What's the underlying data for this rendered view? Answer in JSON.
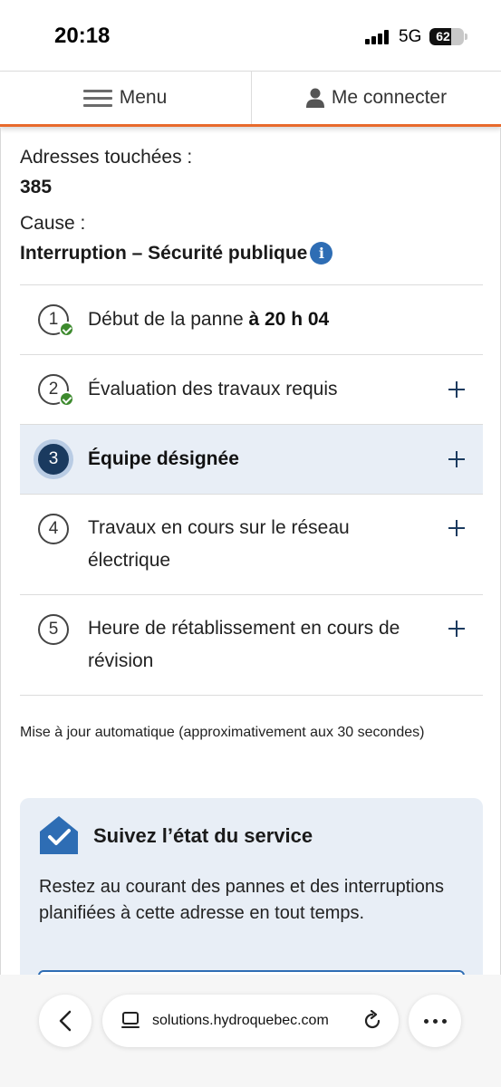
{
  "status_bar": {
    "time": "20:18",
    "network": "5G",
    "battery_level": "62",
    "battery_fraction": 0.62
  },
  "header": {
    "menu_label": "Menu",
    "menu_icon": "hamburger-icon",
    "login_label": "Me connecter",
    "login_icon": "user-icon",
    "accent_color": "#e86a2c"
  },
  "outage": {
    "addresses_label": "Adresses touchées :",
    "addresses_value": "385",
    "cause_label": "Cause :",
    "cause_value": "Interruption – Sécurité publique",
    "cause_info_icon": "info-icon",
    "cause_info_glyph": "i"
  },
  "steps": [
    {
      "number": "1",
      "label": "Début de la panne ",
      "detail": "à 20 h 04",
      "status": "done",
      "expandable": false
    },
    {
      "number": "2",
      "label": "Évaluation des travaux requis",
      "detail": "",
      "status": "done",
      "expandable": true
    },
    {
      "number": "3",
      "label": "Équipe désignée",
      "detail": "",
      "status": "current",
      "expandable": true
    },
    {
      "number": "4",
      "label_line1": "Travaux en cours sur le réseau",
      "label_line2": "électrique",
      "status": "pending",
      "expandable": true
    },
    {
      "number": "5",
      "label_line1": "Heure de rétablissement en cours de",
      "label_line2": "révision",
      "status": "pending",
      "expandable": true
    }
  ],
  "auto_update_text": "Mise à jour automatique (approximativement aux 30 secondes)",
  "service_card": {
    "icon": "house-check-icon",
    "title": "Suivez l’état du service",
    "body": "Restez au courant des pannes et des interruptions planifiées à cette adresse en tout temps."
  },
  "browser": {
    "url": "solutions.hydroquebec.com",
    "back_icon": "chevron-left-icon",
    "tabs_icon": "tabs-icon",
    "reload_icon": "reload-icon",
    "more_icon": "more-icon"
  },
  "colors": {
    "primary_blue": "#2e6db4",
    "navy": "#1a3a5f",
    "success_green": "#3d8a2e",
    "card_background": "#e8eef6"
  }
}
